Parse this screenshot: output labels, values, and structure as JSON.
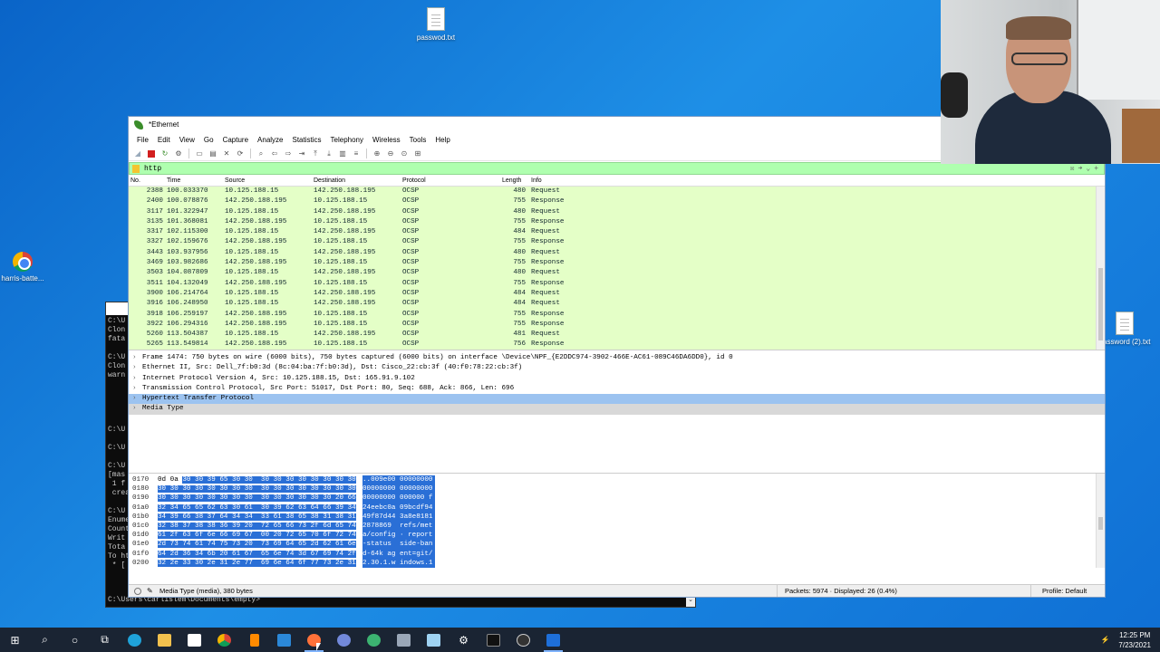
{
  "desktop": {
    "icons": [
      {
        "label": "passwod.txt",
        "icon": "text-file-icon"
      },
      {
        "label": "harris-batte...",
        "icon": "chrome-shortcut-icon"
      },
      {
        "label": "password (2).txt",
        "icon": "text-file-icon"
      }
    ]
  },
  "terminal": {
    "lines": [
      "C:\\U",
      "Clon",
      "fata",
      "",
      "C:\\U",
      "Clon",
      "warn",
      "",
      "",
      "",
      "",
      "",
      "C:\\U",
      "",
      "C:\\U",
      "",
      "C:\\U",
      "[mas",
      " 1 f",
      " crea",
      "",
      "C:\\U",
      "Enume",
      "Count",
      "Writ",
      "Tota",
      "To ht",
      " * ["
    ],
    "prompt": "C:\\Users\\carlislem\\Documents\\empty>"
  },
  "wireshark": {
    "title": "*Ethernet",
    "menu": [
      "File",
      "Edit",
      "View",
      "Go",
      "Capture",
      "Analyze",
      "Statistics",
      "Telephony",
      "Wireless",
      "Tools",
      "Help"
    ],
    "filter": "http",
    "columns": {
      "no": "No.",
      "time": "Time",
      "source": "Source",
      "destination": "Destination",
      "protocol": "Protocol",
      "length": "Length",
      "info": "Info"
    },
    "packets": [
      {
        "no": "2388",
        "time": "100.033370",
        "src": "10.125.188.15",
        "dst": "142.250.188.195",
        "proto": "OCSP",
        "len": "480",
        "info": "Request"
      },
      {
        "no": "2400",
        "time": "100.078876",
        "src": "142.250.188.195",
        "dst": "10.125.188.15",
        "proto": "OCSP",
        "len": "755",
        "info": "Response"
      },
      {
        "no": "3117",
        "time": "101.322947",
        "src": "10.125.188.15",
        "dst": "142.250.188.195",
        "proto": "OCSP",
        "len": "480",
        "info": "Request"
      },
      {
        "no": "3135",
        "time": "101.368081",
        "src": "142.250.188.195",
        "dst": "10.125.188.15",
        "proto": "OCSP",
        "len": "755",
        "info": "Response"
      },
      {
        "no": "3317",
        "time": "102.115300",
        "src": "10.125.188.15",
        "dst": "142.250.188.195",
        "proto": "OCSP",
        "len": "484",
        "info": "Request"
      },
      {
        "no": "3327",
        "time": "102.159676",
        "src": "142.250.188.195",
        "dst": "10.125.188.15",
        "proto": "OCSP",
        "len": "755",
        "info": "Response"
      },
      {
        "no": "3443",
        "time": "103.937956",
        "src": "10.125.188.15",
        "dst": "142.250.188.195",
        "proto": "OCSP",
        "len": "480",
        "info": "Request"
      },
      {
        "no": "3469",
        "time": "103.982686",
        "src": "142.250.188.195",
        "dst": "10.125.188.15",
        "proto": "OCSP",
        "len": "755",
        "info": "Response"
      },
      {
        "no": "3503",
        "time": "104.087809",
        "src": "10.125.188.15",
        "dst": "142.250.188.195",
        "proto": "OCSP",
        "len": "480",
        "info": "Request"
      },
      {
        "no": "3511",
        "time": "104.132049",
        "src": "142.250.188.195",
        "dst": "10.125.188.15",
        "proto": "OCSP",
        "len": "755",
        "info": "Response"
      },
      {
        "no": "3900",
        "time": "106.214764",
        "src": "10.125.188.15",
        "dst": "142.250.188.195",
        "proto": "OCSP",
        "len": "484",
        "info": "Request"
      },
      {
        "no": "3916",
        "time": "106.248950",
        "src": "10.125.188.15",
        "dst": "142.250.188.195",
        "proto": "OCSP",
        "len": "484",
        "info": "Request"
      },
      {
        "no": "3918",
        "time": "106.259197",
        "src": "142.250.188.195",
        "dst": "10.125.188.15",
        "proto": "OCSP",
        "len": "755",
        "info": "Response"
      },
      {
        "no": "3922",
        "time": "106.294316",
        "src": "142.250.188.195",
        "dst": "10.125.188.15",
        "proto": "OCSP",
        "len": "755",
        "info": "Response"
      },
      {
        "no": "5260",
        "time": "113.504387",
        "src": "10.125.188.15",
        "dst": "142.250.188.195",
        "proto": "OCSP",
        "len": "481",
        "info": "Request"
      },
      {
        "no": "5265",
        "time": "113.549814",
        "src": "142.250.188.195",
        "dst": "10.125.188.15",
        "proto": "OCSP",
        "len": "756",
        "info": "Response"
      }
    ],
    "details": [
      "Frame 1474: 750 bytes on wire (6000 bits), 750 bytes captured (6000 bits) on interface \\Device\\NPF_{E2DDC974-3902-466E-AC61-089C46DA6DD0}, id 0",
      "Ethernet II, Src: Dell_7f:b0:3d (8c:04:ba:7f:b0:3d), Dst: Cisco_22:cb:3f (40:f0:78:22:cb:3f)",
      "Internet Protocol Version 4, Src: 10.125.188.15, Dst: 165.91.9.102",
      "Transmission Control Protocol, Src Port: 51017, Dst Port: 80, Seq: 688, Ack: 866, Len: 696",
      "Hypertext Transfer Protocol",
      "Media Type"
    ],
    "bytes": [
      {
        "off": "0170",
        "pre": "0d 0a ",
        "hex": "30 30 39 65 30 30  30 30 30 30 30 30 30 30",
        "asc": "..009e00 00000000"
      },
      {
        "off": "0180",
        "pre": "",
        "hex": "30 30 30 30 30 30 30 30  30 30 30 30 30 30 30 30",
        "asc": "00000000 00000000"
      },
      {
        "off": "0190",
        "pre": "",
        "hex": "30 30 30 30 30 30 30 30  30 30 30 30 30 30 20 66",
        "asc": "00000000 000000 f"
      },
      {
        "off": "01a0",
        "pre": "",
        "hex": "32 34 65 65 62 63 30 61  30 39 62 63 64 66 39 34",
        "asc": "24eebc0a 09bcdf94"
      },
      {
        "off": "01b0",
        "pre": "",
        "hex": "34 39 66 38 37 64 34 34  33 61 38 65 38 31 38 31",
        "asc": "49f87d44 3a8e8181"
      },
      {
        "off": "01c0",
        "pre": "",
        "hex": "32 38 37 38 38 36 39 20  72 65 66 73 2f 6d 65 74",
        "asc": "2878869  refs/met"
      },
      {
        "off": "01d0",
        "pre": "",
        "hex": "61 2f 63 6f 6e 66 69 67  00 20 72 65 70 6f 72 74",
        "asc": "a/config · report"
      },
      {
        "off": "01e0",
        "pre": "",
        "hex": "2d 73 74 61 74 75 73 20  73 69 64 65 2d 62 61 6e",
        "asc": "-status  side-ban"
      },
      {
        "off": "01f0",
        "pre": "",
        "hex": "64 2d 36 34 6b 20 61 67  65 6e 74 3d 67 69 74 2f",
        "asc": "d-64k ag ent=git/"
      },
      {
        "off": "0200",
        "pre": "",
        "hex": "32 2e 33 30 2e 31 2e 77  69 6e 64 6f 77 73 2e 31",
        "asc": "2.30.1.w indows.1"
      }
    ],
    "status": {
      "left": "Media Type (media), 380 bytes",
      "middle": "Packets: 5974 · Displayed: 26 (0.4%)",
      "right": "Profile: Default"
    }
  },
  "taskbar": {
    "apps": [
      "start-icon",
      "search-icon",
      "cortana-icon",
      "task-view-icon",
      "edge-icon",
      "file-explorer-icon",
      "store-icon",
      "chrome-icon",
      "sublime-icon",
      "mail-icon",
      "firefox-icon",
      "discord-icon",
      "globe-icon",
      "network-tool-icon",
      "notepad-icon",
      "settings-icon",
      "terminal-icon",
      "github-icon",
      "wireshark-icon"
    ],
    "time": "12:25 PM",
    "date": "7/23/2021"
  }
}
